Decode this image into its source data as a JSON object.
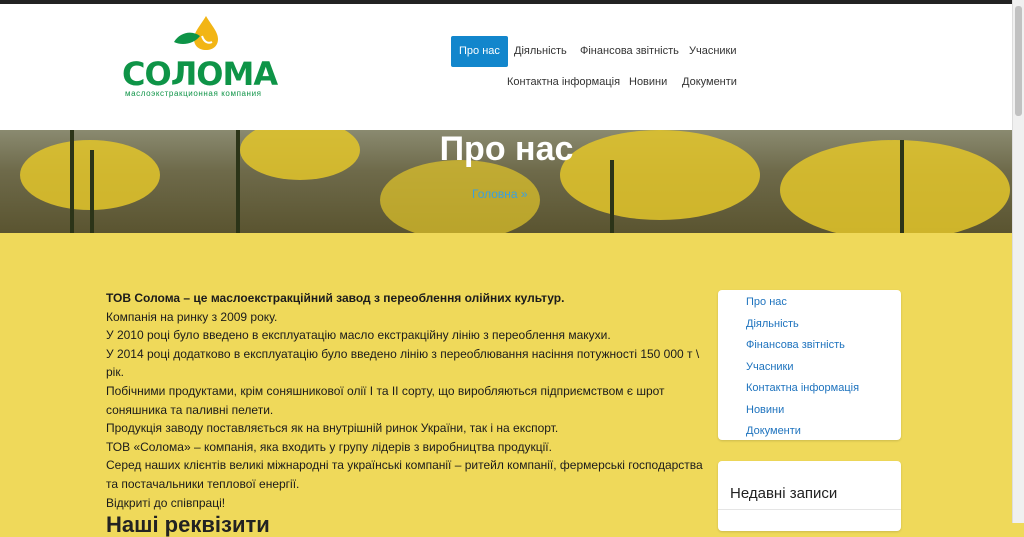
{
  "header": {
    "logo": {
      "word": "СОЛОМА",
      "subtitle": "маслоэкстракционная компания"
    },
    "nav": [
      {
        "label": "Про нас"
      },
      {
        "label": "Діяльність"
      },
      {
        "label": "Фінансова звітність"
      },
      {
        "label": "Учасники"
      },
      {
        "label": "Контактна інформація"
      },
      {
        "label": "Новини"
      },
      {
        "label": "Документи"
      }
    ]
  },
  "hero": {
    "title": "Про нас",
    "breadcrumb": "Головна  »"
  },
  "content": {
    "lead": "ТОВ Солома – це маслоекстракційний завод з переоблення олійних культур.",
    "paragraphs": [
      "Компанія на ринку з 2009 року.",
      "У 2010 році було введено в експлуатацію масло екстракційну лінію з переоблення макухи.",
      "У 2014 році додатково в експлуатацію було введено лінію з переоблювання насіння потужності 150 000 т \\ рік.",
      "Побічними продуктами, крім соняшникової олії І та ІІ сорту, що виробляються підприємством є шрот соняшника та паливні пелети.",
      "Продукція заводу поставляється як на внутрішній ринок України, так і на експорт.",
      "ТОВ «Солома» – компанія, яка входить у групу лідерів з виробництва продукції.",
      "Серед наших клієнтів великі міжнародні та українські компанії – ритейл компанії, фермерські господарства та постачальники теплової енергії.",
      "Відкриті до співпраці!"
    ],
    "heading": "Наші реквізити"
  },
  "sidebar": {
    "links": [
      {
        "label": "Про нас"
      },
      {
        "label": "Діяльність"
      },
      {
        "label": "Фінансова звітність"
      },
      {
        "label": "Учасники"
      },
      {
        "label": "Контактна інформація"
      },
      {
        "label": "Новини"
      },
      {
        "label": "Документи"
      }
    ],
    "recent_title": "Недавні записи"
  },
  "colors": {
    "accent": "#1286cc",
    "brand": "#0e9447",
    "page_bg": "#efd95a",
    "link": "#1e73be"
  }
}
